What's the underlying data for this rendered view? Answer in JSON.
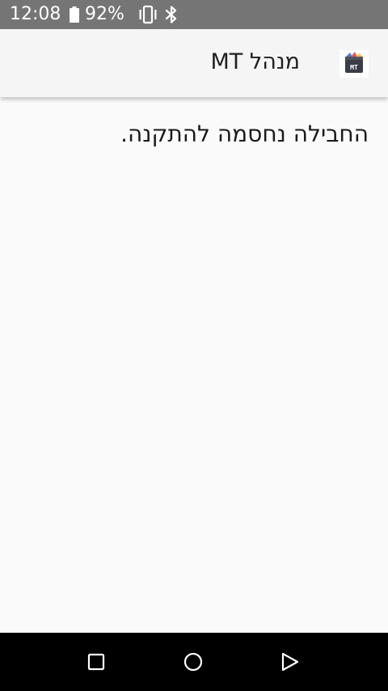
{
  "status_bar": {
    "time": "12:08",
    "battery_percent": "92%",
    "battery_level": 0.92,
    "icons": [
      "battery-icon",
      "vibrate-icon",
      "bluetooth-icon"
    ],
    "background": "#757575"
  },
  "app_bar": {
    "title": "מנהל MT",
    "logo_icon": "mt-manager-logo-icon",
    "background": "#f5f5f5"
  },
  "content": {
    "message": "החבילה נחסמה להתקנה."
  },
  "nav_bar": {
    "buttons": [
      "recents-icon",
      "home-icon",
      "back-icon"
    ],
    "background": "#000000"
  }
}
